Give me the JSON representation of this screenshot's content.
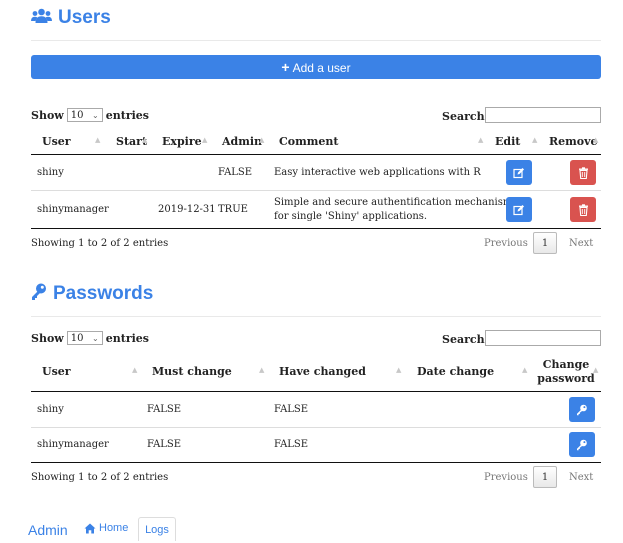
{
  "users_section": {
    "title": "Users",
    "add_button": "Add a user",
    "show_label": "Show",
    "entries_label": "entries",
    "page_length": "10",
    "search_label": "Search:",
    "search_value": "",
    "columns": [
      "User",
      "Start",
      "Expire",
      "Admin",
      "Comment",
      "Edit",
      "Remove"
    ],
    "rows": [
      {
        "user": "shiny",
        "start": "",
        "expire": "",
        "admin": "FALSE",
        "comment_lines": [
          "Easy interactive web applications with R"
        ]
      },
      {
        "user": "shinymanager",
        "start": "",
        "expire": "2019-12-31",
        "admin": "TRUE",
        "comment_lines": [
          "Simple and secure authentification mechanism",
          "for single 'Shiny' applications."
        ]
      }
    ],
    "info": "Showing 1 to 2 of 2 entries",
    "pagination": {
      "previous": "Previous",
      "current": "1",
      "next": "Next"
    }
  },
  "passwords_section": {
    "title": "Passwords",
    "show_label": "Show",
    "entries_label": "entries",
    "page_length": "10",
    "search_label": "Search:",
    "search_value": "",
    "columns": [
      "User",
      "Must change",
      "Have changed",
      "Date change",
      "Change",
      "password"
    ],
    "rows": [
      {
        "user": "shiny",
        "must_change": "FALSE",
        "have_changed": "FALSE",
        "date_change": ""
      },
      {
        "user": "shinymanager",
        "must_change": "FALSE",
        "have_changed": "FALSE",
        "date_change": ""
      }
    ],
    "info": "Showing 1 to 2 of 2 entries",
    "pagination": {
      "previous": "Previous",
      "current": "1",
      "next": "Next"
    }
  },
  "footer": {
    "brand": "Admin",
    "home": "Home",
    "logs": "Logs"
  },
  "colors": {
    "accent": "#3b82e6",
    "danger": "#d9534f"
  },
  "icons": [
    "users-icon",
    "plus-icon",
    "edit-icon",
    "trash-icon",
    "key-icon",
    "home-icon"
  ]
}
